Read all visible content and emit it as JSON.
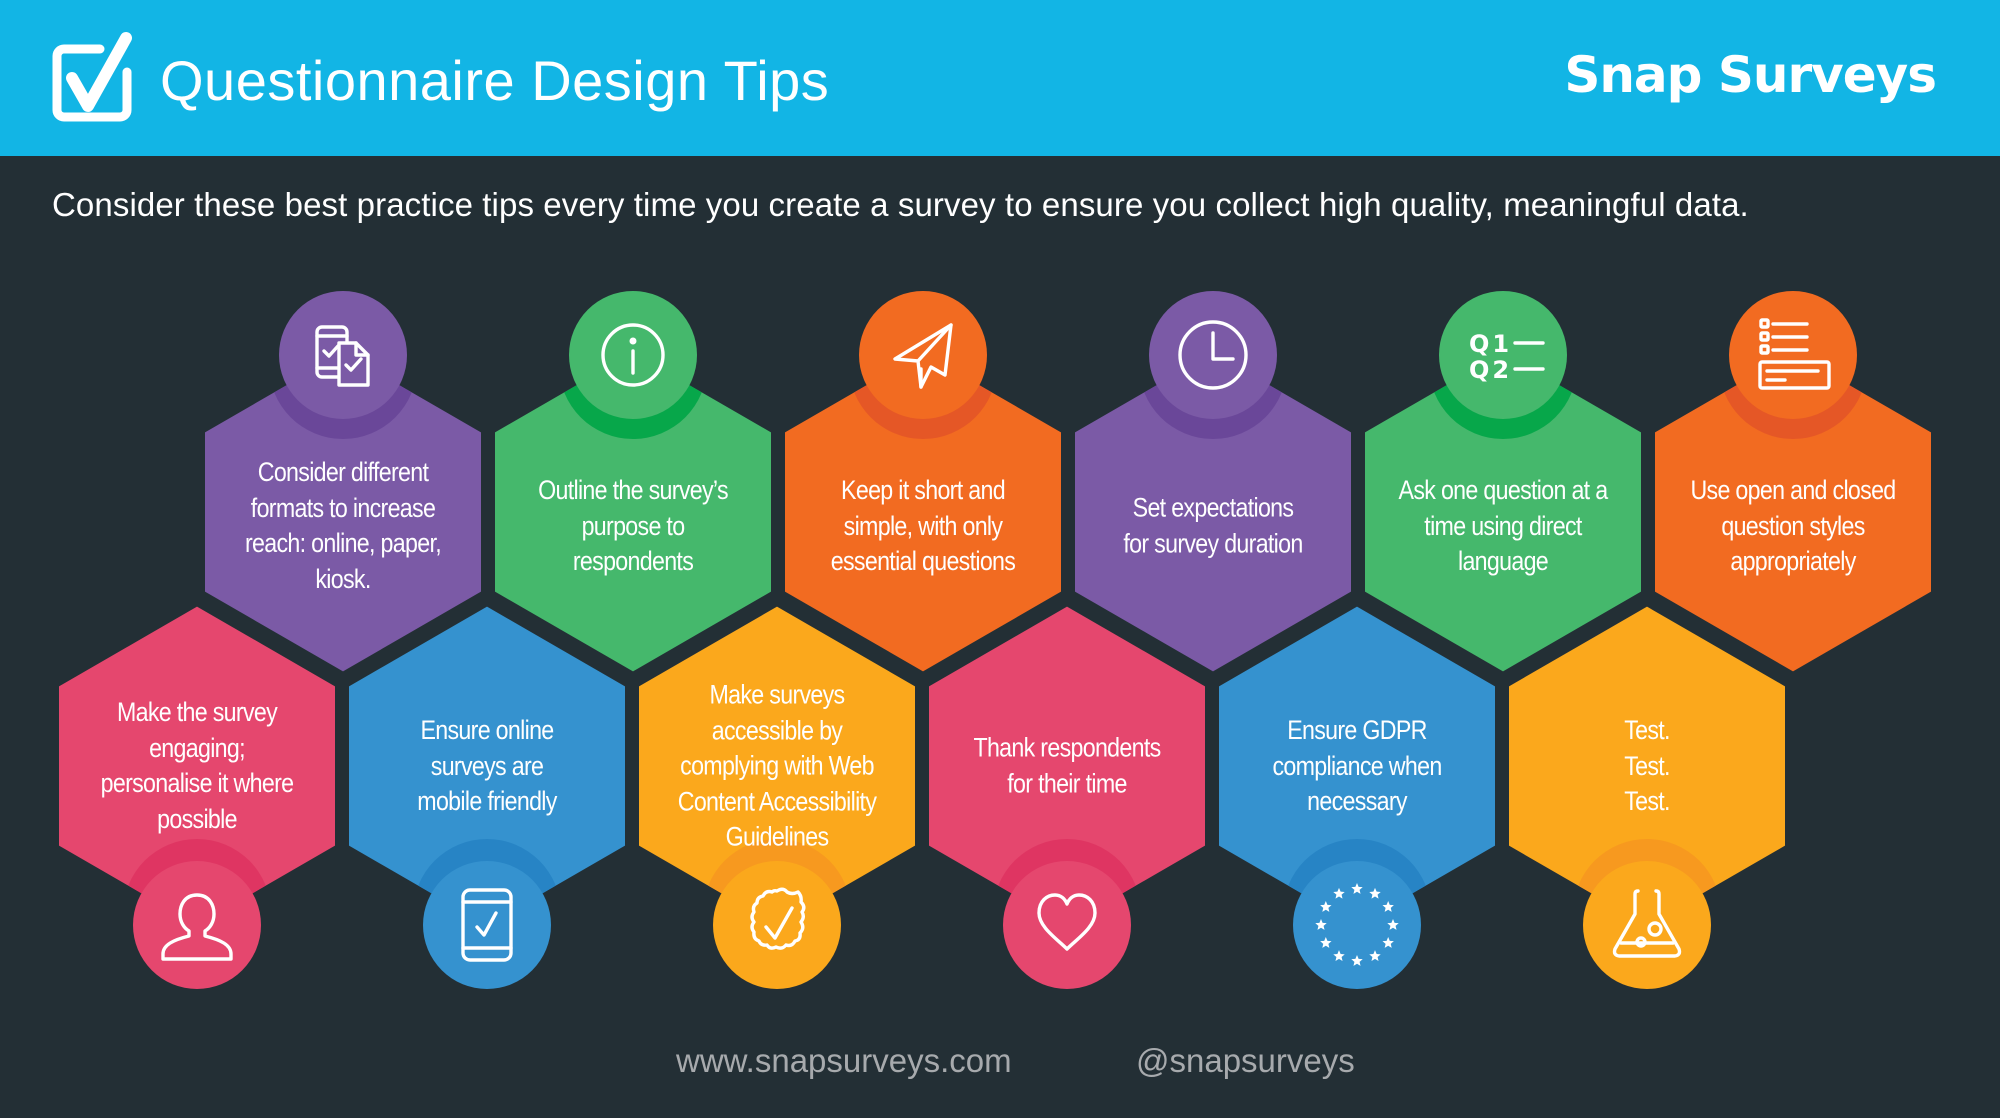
{
  "header": {
    "icon": "checkbox-checked-icon",
    "title": "Questionnaire Design Tips",
    "brand": "Snap Surveys",
    "background_color": "#12b5e5"
  },
  "subtitle": "Consider these best practice tips every time you create a survey to ensure you collect high quality, meaningful data.",
  "colors": {
    "background": "#232f35",
    "purple": "#7b5aa6",
    "purple_shadow": "#6a4799",
    "green": "#45b86c",
    "green_shadow": "#07a74a",
    "orange": "#f26b21",
    "orange_shadow": "#e55726",
    "pink": "#e5476e",
    "pink_shadow": "#df3562",
    "blue": "#3592cf",
    "blue_shadow": "#2784c5",
    "yellow": "#fba81c",
    "yellow_shadow": "#f7991f"
  },
  "tips": [
    {
      "row": "top",
      "color": "purple",
      "icon": "devices-check-icon",
      "lines": [
        "Consider different",
        "formats to increase",
        "reach: online, paper,",
        "kiosk."
      ]
    },
    {
      "row": "top",
      "color": "green",
      "icon": "info-icon",
      "lines": [
        "Outline the survey’s",
        "purpose to",
        "respondents"
      ]
    },
    {
      "row": "top",
      "color": "orange",
      "icon": "paper-plane-icon",
      "lines": [
        "Keep it short and",
        "simple, with only",
        "essential questions"
      ]
    },
    {
      "row": "top",
      "color": "purple",
      "icon": "clock-icon",
      "lines": [
        "Set expectations",
        "for survey duration"
      ]
    },
    {
      "row": "top",
      "color": "green",
      "icon": "q1-q2-list-icon",
      "icon_text": [
        "Q1",
        "Q2"
      ],
      "lines": [
        "Ask one question at a",
        "time using direct",
        "language"
      ]
    },
    {
      "row": "top",
      "color": "orange",
      "icon": "checklist-form-icon",
      "lines": [
        "Use open and closed",
        "question styles",
        "appropriately"
      ]
    },
    {
      "row": "bottom",
      "color": "pink",
      "icon": "user-icon",
      "lines": [
        "Make the survey",
        "engaging;",
        "personalise it where",
        "possible"
      ]
    },
    {
      "row": "bottom",
      "color": "blue",
      "icon": "mobile-check-icon",
      "lines": [
        "Ensure online",
        "surveys are",
        "mobile friendly"
      ]
    },
    {
      "row": "bottom",
      "color": "yellow",
      "icon": "badge-check-icon",
      "lines": [
        "Make surveys",
        "accessible by",
        "complying with Web",
        "Content Accessibility",
        "Guidelines"
      ]
    },
    {
      "row": "bottom",
      "color": "pink",
      "icon": "heart-icon",
      "lines": [
        "Thank respondents",
        "for their time"
      ]
    },
    {
      "row": "bottom",
      "color": "blue",
      "icon": "eu-stars-icon",
      "lines": [
        "Ensure GDPR",
        "compliance when",
        "necessary"
      ]
    },
    {
      "row": "bottom",
      "color": "yellow",
      "icon": "flask-icon",
      "lines": [
        "Test.",
        "Test.",
        "Test."
      ]
    }
  ],
  "footer": {
    "website": "www.snapsurveys.com",
    "handle": "@snapsurveys"
  }
}
